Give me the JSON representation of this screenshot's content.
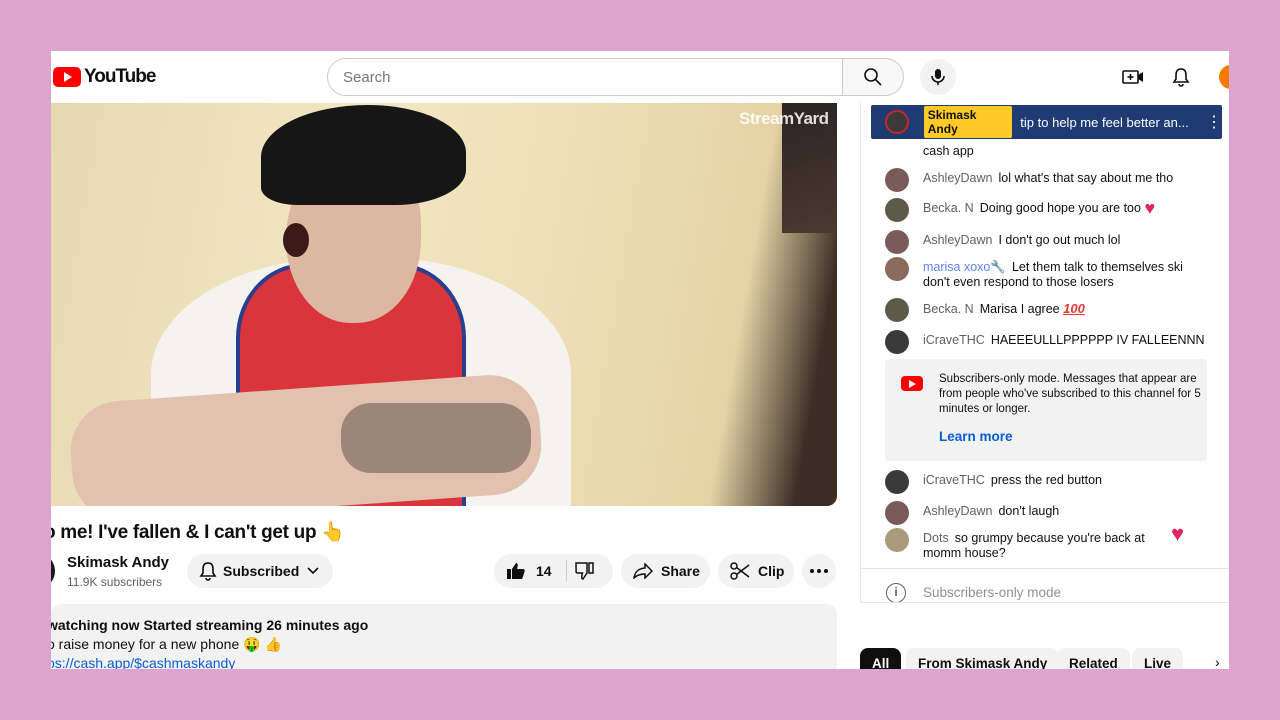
{
  "header": {
    "logo_text": "YouTube",
    "search_placeholder": "Search"
  },
  "video": {
    "watermark": "StreamYard",
    "title": "o me! I've fallen & I can't get up 👆"
  },
  "channel": {
    "name": "Skimask Andy",
    "subscribers": "11.9K subscribers",
    "subscribed_label": "Subscribed"
  },
  "actions": {
    "like_count": "14",
    "share_label": "Share",
    "clip_label": "Clip"
  },
  "description": {
    "line1": "watching now  Started streaming 26 minutes ago",
    "line2": "o raise money for a new phone 🤑 👍",
    "link": "os://cash.app/$cashmaskandy"
  },
  "chat": {
    "pinned": {
      "author": "Skimask Andy",
      "text": "tip to help me feel better an..."
    },
    "partial_message": "cash app",
    "messages": [
      {
        "author": "AshleyDawn",
        "text": "lol what's that say about me tho"
      },
      {
        "author": "Becka. N",
        "text": "Doing good hope you are too"
      },
      {
        "author": "AshleyDawn",
        "text": "I don't go out much lol"
      },
      {
        "author": "marisa xoxo🔧",
        "text": "Let them talk to themselves ski don't even respond to those losers"
      },
      {
        "author": "Becka. N",
        "text": "Marisa I agree"
      },
      {
        "author": "iCraveTHC",
        "text": "HAEEEULLLPPPPPP IV FALLEENNN"
      }
    ],
    "notice": {
      "text": "Subscribers-only mode. Messages that appear are from people who've subscribed to this channel for 5 minutes or longer.",
      "link": "Learn more"
    },
    "messages_after": [
      {
        "author": "iCraveTHC",
        "text": "press the red button"
      },
      {
        "author": "AshleyDawn",
        "text": "don't laugh"
      },
      {
        "author": "Dots",
        "text": "so grumpy because you're back at momm house?"
      }
    ],
    "footer_text": "Subscribers-only mode"
  },
  "chips": [
    "All",
    "From Skimask Andy",
    "Related",
    "Live"
  ],
  "colors": {
    "background": "#dca5cf",
    "youtube_red": "#ff0000",
    "pinned_bg": "#1f3b73",
    "pinned_name_bg": "#ffca28",
    "link_blue": "#065fd4"
  }
}
